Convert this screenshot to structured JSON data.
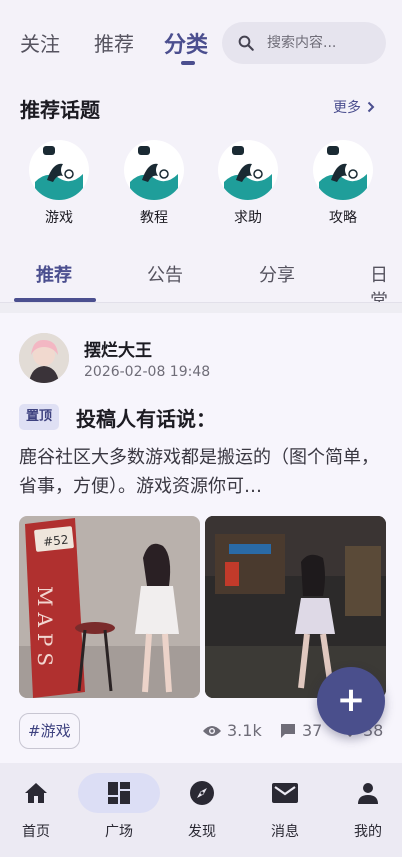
{
  "top_tabs": [
    "关注",
    "推荐",
    "分类"
  ],
  "search": {
    "placeholder": "搜索内容..."
  },
  "topics": {
    "title": "推荐话题",
    "more": "更多",
    "items": [
      {
        "label": "游戏",
        "icon": "topic-logo-icon"
      },
      {
        "label": "教程",
        "icon": "topic-logo-icon"
      },
      {
        "label": "求助",
        "icon": "topic-logo-icon"
      },
      {
        "label": "攻略",
        "icon": "topic-logo-icon"
      }
    ]
  },
  "content_tabs": [
    "推荐",
    "公告",
    "分享",
    "日常"
  ],
  "post": {
    "author": "摆烂大王",
    "time": "2026-02-08 19:48",
    "pin": "置顶",
    "title": "投稿人有话说：",
    "excerpt": "鹿谷社区大多数游戏都是搬运的（图个简单，省事，方便）。游戏资源你可…",
    "image_sign_text": "MAPS",
    "image_card_text": "#52",
    "tag": "#游戏",
    "views": "3.1k",
    "comments": "37",
    "likes": "38"
  },
  "bottom_nav": [
    "首页",
    "广场",
    "发现",
    "消息",
    "我的"
  ],
  "colors": {
    "accent": "#4b4f8f",
    "fab": "#4a4f8c",
    "teal_logo": "#1f9e9a"
  }
}
